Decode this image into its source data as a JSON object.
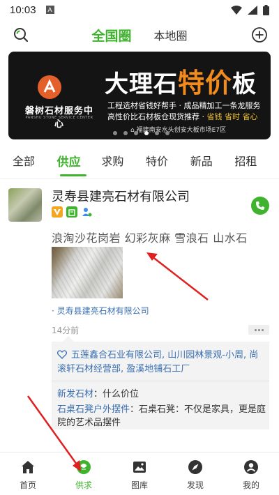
{
  "status_bar": {
    "time": "10:03",
    "notif_letter": "A"
  },
  "top_nav": {
    "tab_active": "全国圈",
    "tab_other": "本地圈"
  },
  "banner": {
    "brand": "磐树石材服务中心",
    "brand_sub": "PANSHU STONE SERVICE CENTER",
    "title_pre": "大理石",
    "title_highlight": "特价",
    "title_post": "板",
    "line1": "工程选材省钱好帮手 · 成品精加工一条龙服务",
    "line2_pre": "高性价比石材板仓现货推荐 · ",
    "line2_highlight": "省钱 省时 省心",
    "address": "福建南安水头创安大板市场E7区"
  },
  "categories": [
    "全部",
    "供应",
    "求购",
    "特价",
    "新品",
    "招租"
  ],
  "post": {
    "company": "灵寿县建亮石材有限公司",
    "text": "浪淘沙花岗岩 幻彩灰麻 雪浪石 山水石",
    "source": "· 灵寿县建亮石材有限公司",
    "time": "14分前",
    "likes": "五莲鑫合石业有限公司, 山川园林景观-小周, 尚滚轩石材经营部, 盈溪地铺石工厂",
    "comment1_user": "新发石材",
    "comment1_text": "什么价位",
    "comment2_user": "石桌石凳户外摆件",
    "comment2_text": "石桌石凳：不仅是家具，更是庭院的艺术品摆件"
  },
  "bottom_nav": [
    {
      "label": "首页",
      "icon": "home-icon"
    },
    {
      "label": "供求",
      "icon": "supply-icon"
    },
    {
      "label": "图库",
      "icon": "gallery-icon"
    },
    {
      "label": "发现",
      "icon": "compass-icon"
    },
    {
      "label": "我的",
      "icon": "profile-icon"
    }
  ],
  "colors": {
    "accent": "#3fb22e",
    "link": "#3a6fb0",
    "annotation_arrow": "#e02020",
    "banner_highlight": "#f28a1c"
  }
}
